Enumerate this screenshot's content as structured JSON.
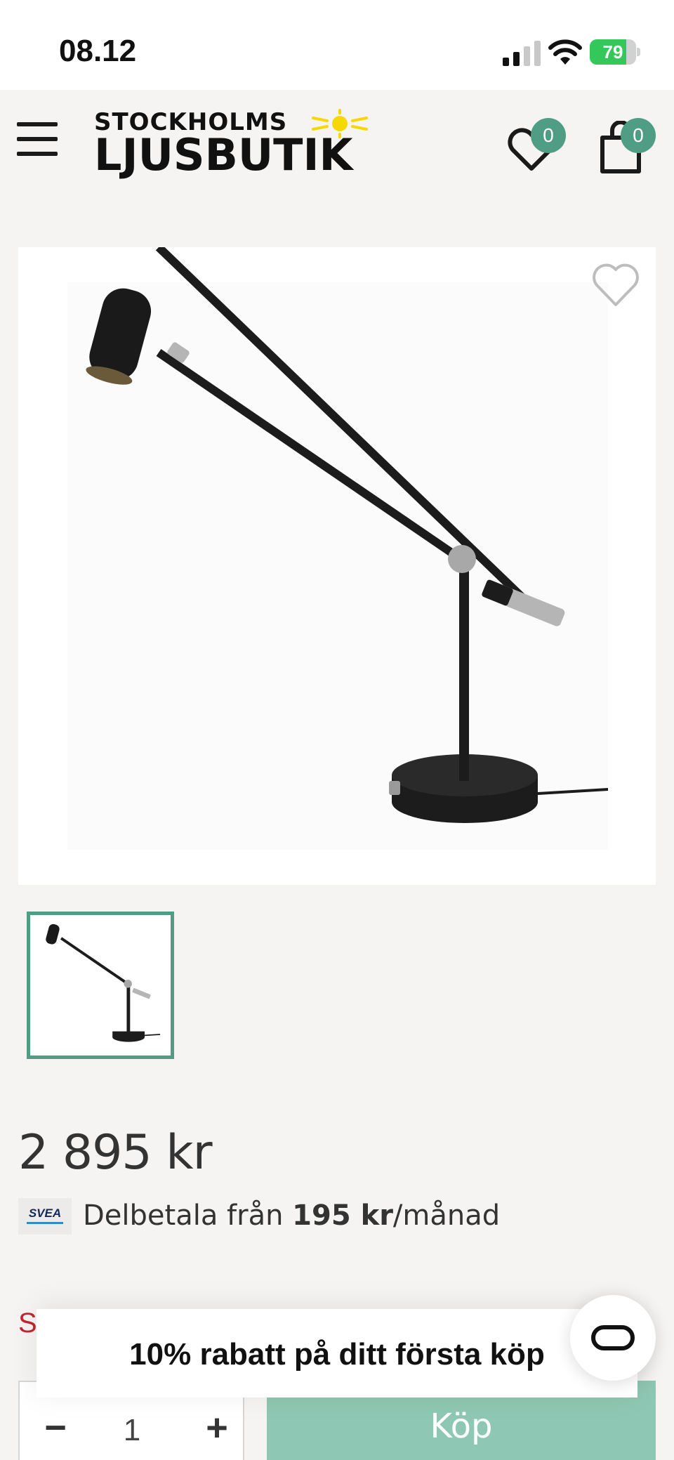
{
  "status_bar": {
    "time": "08.12",
    "battery_percent": 79,
    "battery_text": "79",
    "icons": [
      "signal-icon",
      "wifi-icon",
      "battery-icon"
    ]
  },
  "header": {
    "logo_top": "STOCKHOLMS",
    "logo_bottom": "LJUSBUTIK",
    "wishlist_count": "0",
    "cart_count": "0",
    "icons": [
      "menu-icon",
      "sun-icon",
      "heart-icon",
      "shopping-bag-icon"
    ]
  },
  "product": {
    "price": "2 895 kr",
    "installment_prefix": "Delbetala från ",
    "installment_amount": "195 kr",
    "installment_suffix": "/månad",
    "payment_provider": "SVEA",
    "truncated_text": "S"
  },
  "purchase": {
    "quantity": "1",
    "minus_label": "−",
    "plus_label": "+",
    "buy_label": "Köp"
  },
  "popup": {
    "discount_text": "10% rabatt på ditt första köp"
  },
  "colors": {
    "accent": "#4e9d84",
    "buy_button": "#8ec7b3",
    "background": "#f5f4f2",
    "sale_red": "#c0272d",
    "logo_sun": "#f5d800"
  }
}
